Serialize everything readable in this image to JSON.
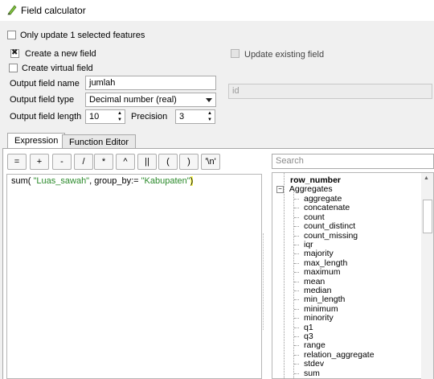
{
  "window": {
    "title": "Field calculator",
    "icon": "pencil-icon"
  },
  "only_update_selected": {
    "label": "Only update 1 selected features",
    "checked": false
  },
  "create_new_field": {
    "label": "Create a new field",
    "checked": true
  },
  "create_virtual_field": {
    "label": "Create virtual field",
    "checked": false
  },
  "update_existing_field": {
    "label": "Update existing field",
    "checked": false,
    "field_placeholder": "id"
  },
  "output_field_name": {
    "label": "Output field name",
    "value": "jumlah"
  },
  "output_field_type": {
    "label": "Output field type",
    "value": "Decimal number (real)"
  },
  "output_field_length": {
    "label": "Output field length",
    "value": "10"
  },
  "precision": {
    "label": "Precision",
    "value": "3"
  },
  "tabs": [
    {
      "label": "Expression",
      "active": true
    },
    {
      "label": "Function Editor",
      "active": false
    }
  ],
  "operators": [
    "=",
    "+",
    "-",
    "/",
    "*",
    "^",
    "||",
    "(",
    ")",
    "'\\n'"
  ],
  "search": {
    "placeholder": "Search"
  },
  "expression": {
    "prefix": "sum(",
    "arg1": " \"Luas_sawah\"",
    "middle": ", group_by:= ",
    "arg2": "\"Kabupaten\"",
    "suffix": ")"
  },
  "function_tree": {
    "top_item": "row_number",
    "group": {
      "label": "Aggregates",
      "expanded": true
    },
    "items": [
      "aggregate",
      "concatenate",
      "count",
      "count_distinct",
      "count_missing",
      "iqr",
      "majority",
      "max_length",
      "maximum",
      "mean",
      "median",
      "min_length",
      "minimum",
      "minority",
      "q1",
      "q3",
      "range",
      "relation_aggregate",
      "stdev",
      "sum"
    ]
  },
  "colors": {
    "string_literal": "#2b8a2b",
    "bracket_highlight": "#ffff66"
  }
}
